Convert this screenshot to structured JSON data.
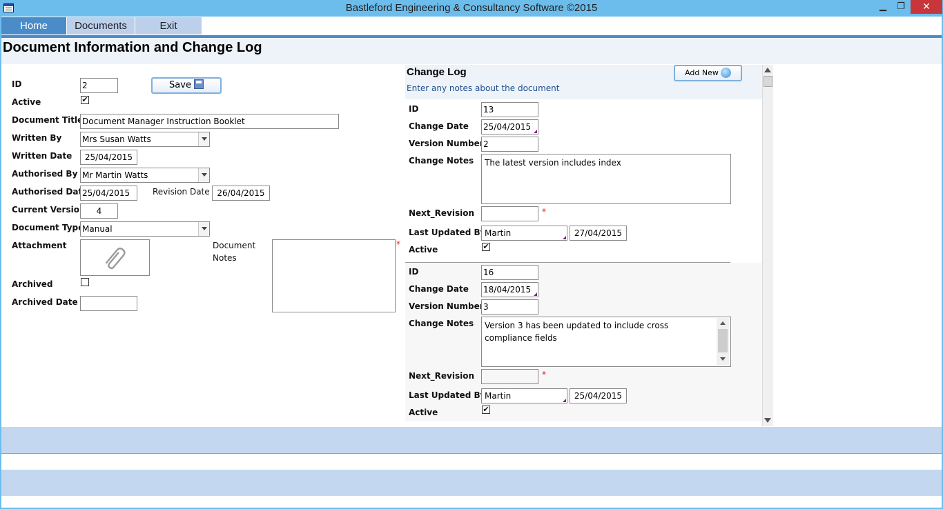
{
  "window": {
    "title": "Bastleford Engineering & Consultancy Software ©2015",
    "min_glyph": "▁",
    "max_glyph": "❐",
    "close_glyph": "✕"
  },
  "nav": {
    "tabs": [
      {
        "label": "Home",
        "active": true
      },
      {
        "label": "Documents"
      },
      {
        "label": "Exit"
      }
    ]
  },
  "page": {
    "title": "Document Information and Change Log"
  },
  "form": {
    "id_label": "ID",
    "id_value": "2",
    "save_label": "Save",
    "active_label": "Active",
    "active_checked": "✔",
    "title_label": "Document Title",
    "title_value": "Document Manager Instruction Booklet",
    "written_by_label": "Written By",
    "written_by_value": "Mrs Susan Watts",
    "written_date_label": "Written Date",
    "written_date_value": "25/04/2015",
    "authorised_by_label": "Authorised By",
    "authorised_by_value": "Mr Martin Watts",
    "authorised_date_label": "Authorised Date",
    "authorised_date_value": "25/04/2015",
    "revision_date_label": "Revision Date",
    "revision_date_value": "26/04/2015",
    "current_version_label": "Current Version",
    "current_version_value": "4",
    "doc_type_label": "Document Type",
    "doc_type_value": "Manual",
    "attachment_label": "Attachment",
    "doc_notes_label_1": "Document",
    "doc_notes_label_2": "Notes",
    "required_mark": "*",
    "archived_label": "Archived",
    "archived_date_label": "Archived Date",
    "archived_date_value": ""
  },
  "change_log": {
    "title": "Change Log",
    "subtitle": "Enter any notes about the document",
    "add_new_label": "Add New",
    "records": [
      {
        "id_label": "ID",
        "id": "13",
        "change_date_label": "Change Date",
        "change_date": "25/04/2015",
        "version_label": "Version Number",
        "version": "2",
        "notes_label": "Change Notes",
        "notes": "The latest version includes index",
        "next_revision_label": "Next_Revision",
        "next_revision": "",
        "updated_by_label": "Last Updated By",
        "updated_by": "Martin",
        "updated_date": "27/04/2015",
        "active_label": "Active",
        "active": "✔"
      },
      {
        "id_label": "ID",
        "id": "16",
        "change_date_label": "Change Date",
        "change_date": "18/04/2015",
        "version_label": "Version Number",
        "version": "3",
        "notes_label": "Change Notes",
        "notes": "Version 3 has been updated to include cross compliance fields",
        "next_revision_label": "Next_Revision",
        "next_revision": "",
        "updated_by_label": "Last Updated By",
        "updated_by": "Martin",
        "updated_date": "25/04/2015",
        "active_label": "Active",
        "active": "✔"
      }
    ]
  },
  "icons": {
    "app": "app-form-icon",
    "save": "floppy-disk-icon",
    "add_new": "globe-add-icon",
    "attachment": "paperclip-icon"
  },
  "colors": {
    "titlebar": "#6cbdec",
    "nav_active": "#4b8cc8",
    "nav_inactive": "#bcd0ec",
    "footer_band": "#c3d7f0",
    "close": "#c7363a"
  }
}
